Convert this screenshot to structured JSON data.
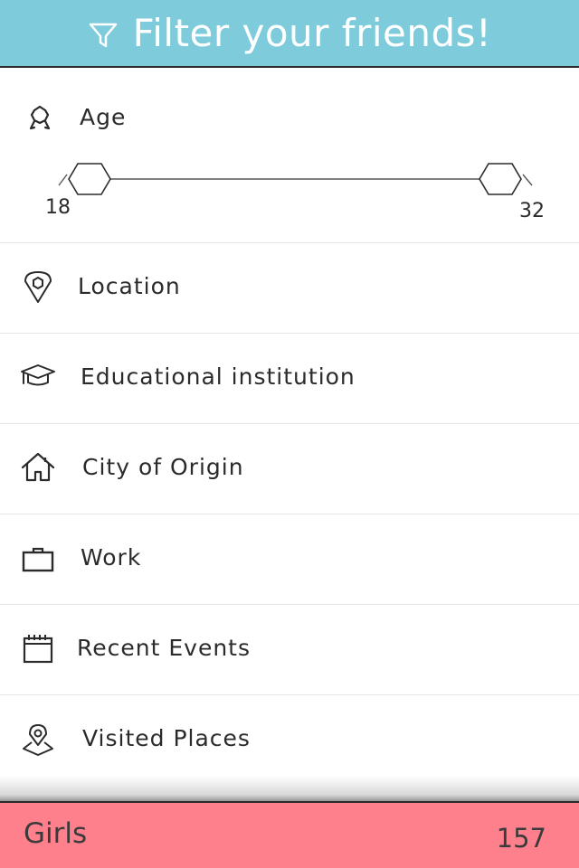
{
  "header": {
    "title": "Filter your friends!",
    "icon": "funnel-icon",
    "background": "#7ecbdc"
  },
  "age": {
    "label": "Age",
    "icon": "award-ribbon-icon",
    "min": "18",
    "max": "32"
  },
  "filters": [
    {
      "label": "Location",
      "icon": "map-pin-icon"
    },
    {
      "label": "Educational institution",
      "icon": "graduation-cap-icon"
    },
    {
      "label": "City of Origin",
      "icon": "home-icon"
    },
    {
      "label": "Work",
      "icon": "briefcase-icon"
    },
    {
      "label": "Recent Events",
      "icon": "calendar-icon"
    },
    {
      "label": "Visited Places",
      "icon": "map-marker-visited-icon"
    }
  ],
  "footer": {
    "gender": "Girls",
    "count": "157",
    "background": "#ff808d"
  }
}
